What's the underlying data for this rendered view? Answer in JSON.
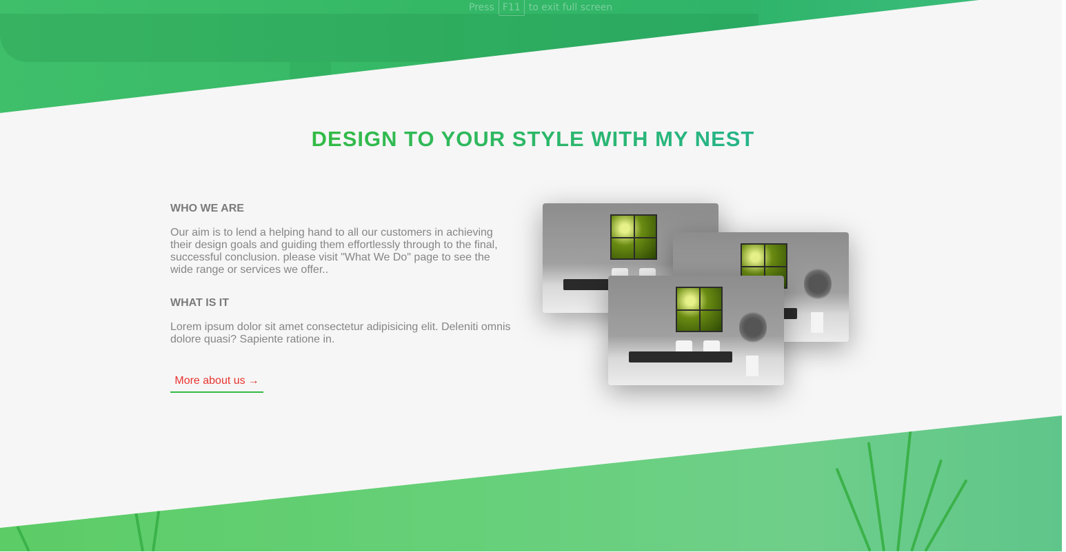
{
  "overlay": {
    "press_label": "Press",
    "key_label": "F11",
    "exit_label": "to exit full screen"
  },
  "section": {
    "heading": "DESIGN TO YOUR STYLE WITH MY NEST"
  },
  "who_we_are": {
    "title": "WHO WE ARE",
    "text": "Our aim is to lend a helping hand to all our customers in achieving their design goals and guiding them effortlessly through to the final, successful conclusion. please visit \"What We Do\" page to see the wide range or services we offer.."
  },
  "what_is_it": {
    "title": "WHAT IS IT",
    "text": "Lorem ipsum dolor sit amet consectetur adipisicing elit. Deleniti omnis dolore quasi? Sapiente ratione in."
  },
  "cta": {
    "label": "More about us",
    "arrow": "→"
  },
  "colors": {
    "brand_green": "#2ab85a",
    "link_red": "#e8332f",
    "text_gray": "#858585",
    "background": "#f6f6f6"
  },
  "gallery": {
    "images": [
      "living-room-photo",
      "living-room-photo",
      "living-room-photo"
    ]
  }
}
